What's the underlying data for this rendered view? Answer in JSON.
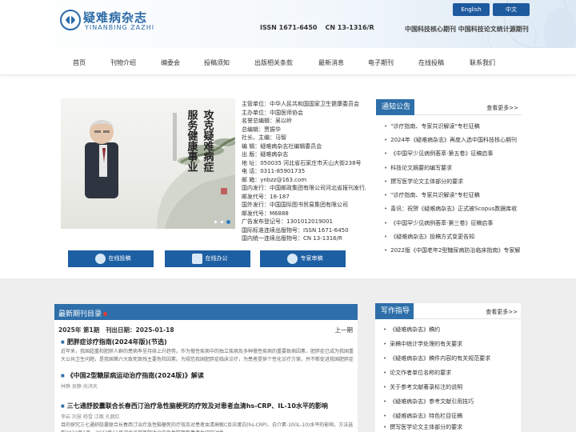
{
  "header": {
    "logo_cn": "疑难病杂志",
    "logo_en": "YINANBING ZAZHI",
    "issn": "ISSN 1671-6450",
    "cn": "CN 13-1316/R",
    "lang_en": "English",
    "lang_cn": "中文",
    "core_text": "中国科技核心期刊 中国科技论文统计源期刊"
  },
  "nav": {
    "items": [
      "首页",
      "刊物介绍",
      "编委会",
      "投稿须知",
      "出版相关条款",
      "最新消息",
      "电子期刊",
      "在线投稿",
      "联系我们"
    ]
  },
  "banner": {
    "calligraphy_right": "攻克疑难病症",
    "calligraphy_left": "服务健康事业"
  },
  "info": {
    "lines": [
      "主管单位：中华人民共和国国家卫生健康委员会",
      "主办单位：中国医师协会",
      "名誉总编辑：吴以岭",
      "总编辑：贾振华",
      "社长、主编：马智",
      "编    辑：疑难病杂志社编辑委员会",
      "出    版：疑难病杂志",
      "地    址：050035 河北省石家庄市天山大街238号",
      "电    话：0311-85901735",
      "邮    箱：ynbzz@163.com",
      "国内发行：中国邮政集团有限公司河北省报刊发行局",
      "邮发代号：18-187",
      "国外发行：中国国际图书贸易集团有限公司",
      "邮发代号：M6888",
      "广告发布登记号：1301012019001",
      "国际标准连续出版物号：ISSN 1671-6450",
      "国内统一连续出版物号：CN 13-1316/R"
    ]
  },
  "actions": {
    "online_submit": "在线投稿",
    "online_office": "在线办公",
    "expert_review": "专家审稿"
  },
  "notice": {
    "title": "通知公告",
    "more": "查看更多>>",
    "items": [
      "\"诊疗指南、专家共识解读\"专栏征稿",
      "2024年《疑难病杂志》再度入选中国科技核心期刊",
      "《中国罕少见病例荟萃·第五卷》征稿启事",
      "科技论文摘要的编写要求",
      "撰写医学论文主体部分的要求",
      "\"诊疗指南、专家共识解读\"专栏征稿",
      "喜讯：祝贺《疑难病杂志》正式被Scopus数据库收",
      "《中国罕少见病例荟萃·第三卷》征稿启事",
      "《疑难病杂志》投稿方式变更告知",
      "2022版《中国老年2型糖尿病防治临床指南》专家解"
    ]
  },
  "latest": {
    "title": "最新期刊目录",
    "issue": "2025年 第1期",
    "date": "刊出日期：2025-01-18",
    "prev": "上一期",
    "articles": [
      {
        "title": "肥胖症诊疗指南(2024年版)(节选)",
        "authors": "",
        "abstract": "近年来，我国超重和肥胖人群的患病率呈持续上升趋势。作为慢性疾病中的独立疾病及多种慢性疾病的重要致病因素，肥胖症已成为我国重大公共卫生问题，是我国第六大致死致残主要危险因素。为规范我国肥胖症临床诊疗，为患者提供个性化诊疗方案，并不断促进我国肥胖症诊疗水平"
      },
      {
        "title": "《中国2型糖尿病运动治疗指南(2024版)》解读",
        "authors": "林静 吴静 尚鸿天",
        "abstract": ""
      },
      {
        "title": "三七通舒胶囊联合长春西汀治疗急性脑梗死的疗效及对患者血清hs-CRP、IL-10水平的影响",
        "authors": "李岩 刘慧 杨雪 江徽 孔朝红",
        "abstract": "目的探究三七通舒胶囊联合长春西汀治疗急性脑梗死的疗效及对患者血清高敏C反应蛋白(hs-CRP)、白介素-10(IL-10)水平的影响。方法选取2022年1月—2023年12月河北省某医院收治的急性脑梗死患者为研究对象。"
      }
    ]
  },
  "guide": {
    "title": "写作指导",
    "more": "查看更多>>",
    "items": [
      "《疑难病杂志》稿约",
      "采稿中统计学处理的有关要求",
      "《疑难病杂志》稿件内容的有关规范要求",
      "论文作者单位名称的要求",
      "关于参考文献著录标注的说明",
      "《疑难病杂志》参考文献引用技巧",
      "《疑难病杂志》特色栏目征稿",
      "撰写医学论文主体部分的要求"
    ]
  },
  "colors": {
    "brand_blue": "#2e6faa",
    "button_blue": "#1d5fa3",
    "new_dot_red": "#e53935"
  }
}
